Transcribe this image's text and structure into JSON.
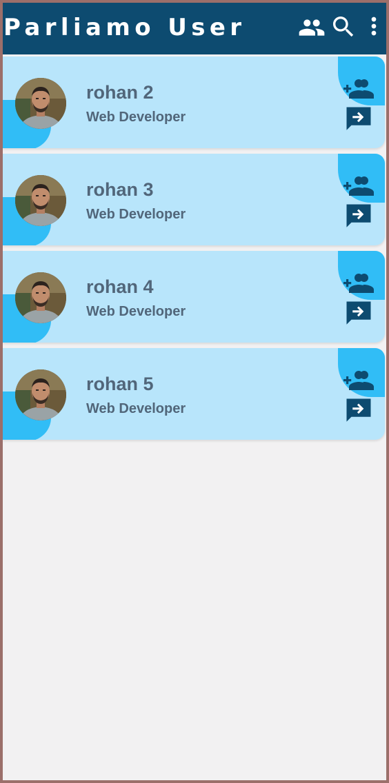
{
  "appbar": {
    "title": "Parliamo User",
    "icons": [
      "group-icon",
      "search-icon",
      "more-vert-icon"
    ]
  },
  "users": [
    {
      "name": "rohan 2",
      "role": "Web Developer"
    },
    {
      "name": "rohan 3",
      "role": "Web Developer"
    },
    {
      "name": "rohan 4",
      "role": "Web Developer"
    },
    {
      "name": "rohan 5",
      "role": "Web Developer"
    }
  ],
  "card_actions": [
    "add-friend-icon",
    "open-chat-icon"
  ],
  "colors": {
    "appbar": "#0d4b70",
    "card_background": "#b8e5fb",
    "accent_blob": "#31bdf6",
    "text": "#51667a",
    "action_icon": "#0d4b70",
    "page_background": "#f2f1f2"
  }
}
